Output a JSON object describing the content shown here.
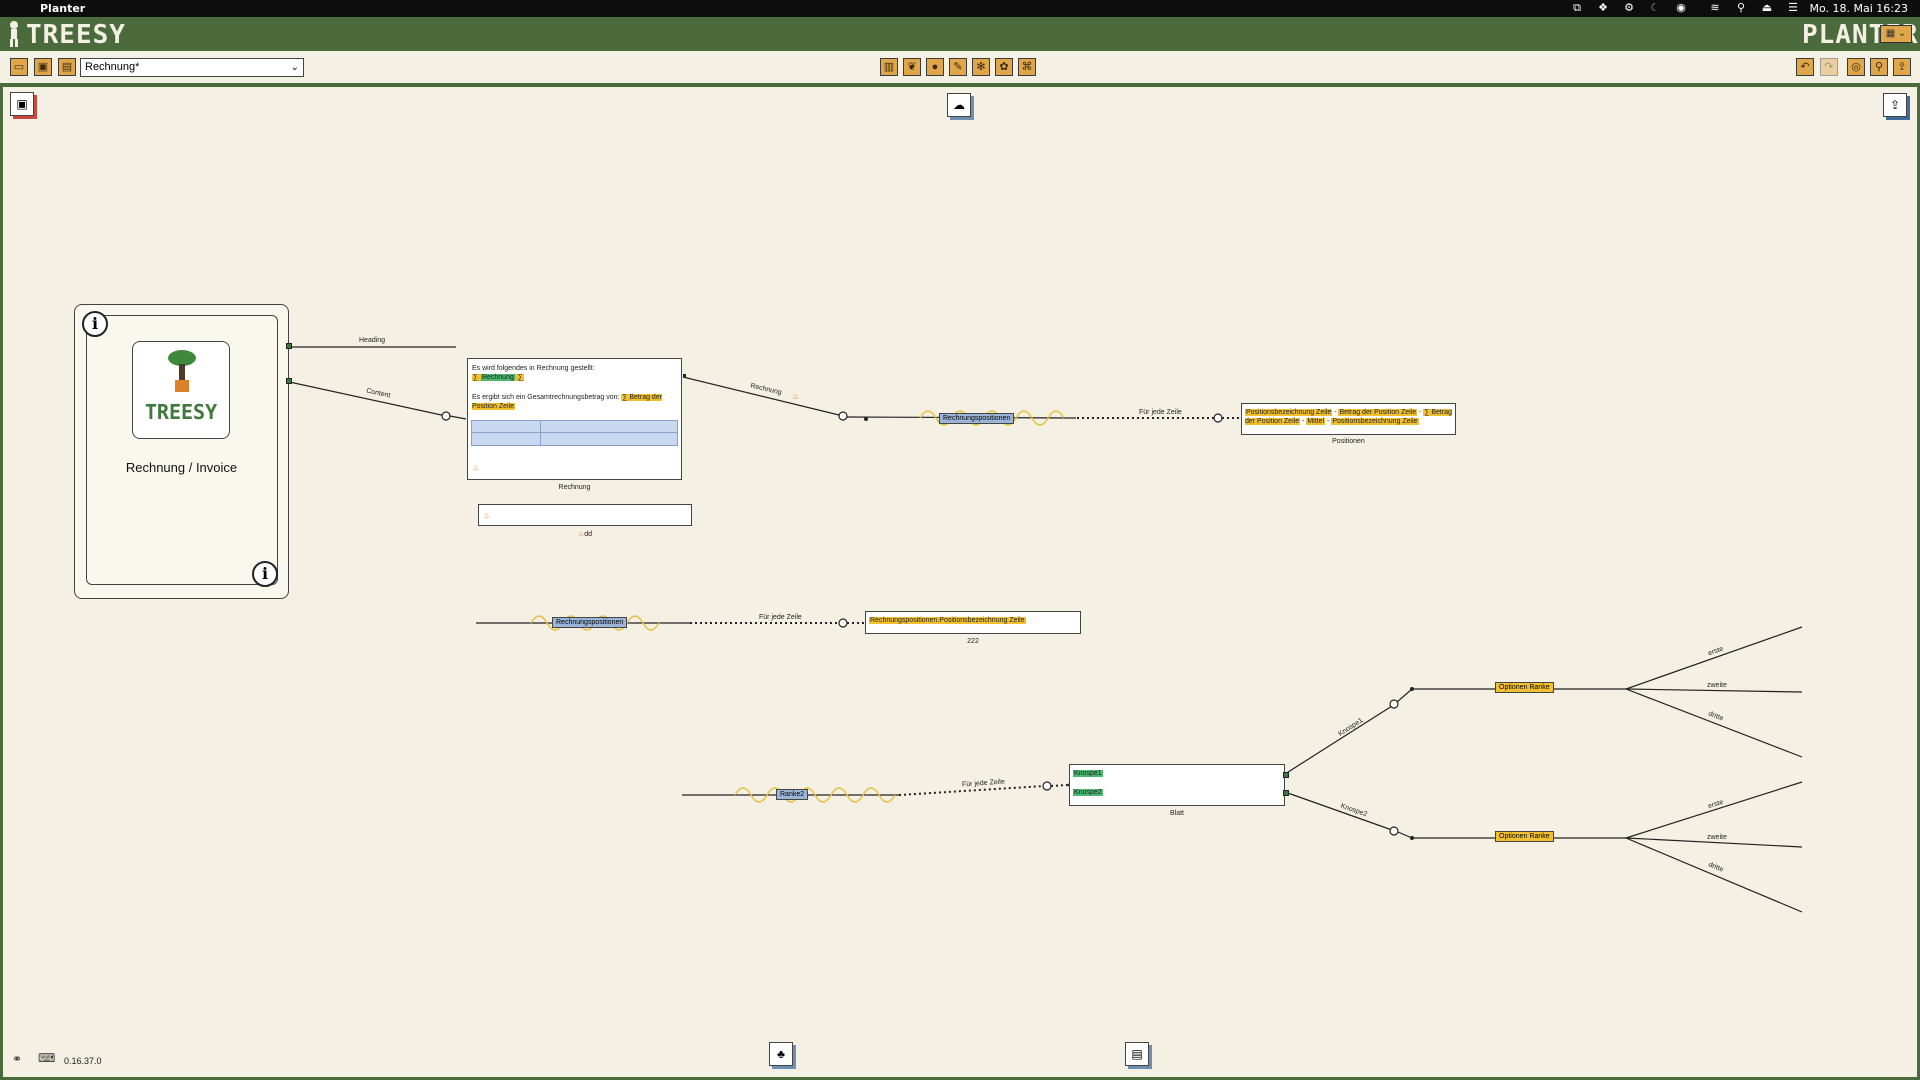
{
  "menubar": {
    "app_name": "Planter",
    "clock": "Mo. 18. Mai 16:23"
  },
  "header": {
    "left_logo": "TREESY",
    "right_logo": "PLANTER"
  },
  "toolbar": {
    "document_select": "Rechnung*"
  },
  "canvas": {
    "info_card": {
      "logo_text": "TREESY",
      "title": "Rechnung / Invoice"
    },
    "edges": {
      "heading": "Heading",
      "content": "Content",
      "rechnung": "Rechnung",
      "fur_jede_zeile": "Für jede Zeile",
      "knospe1": "Knospe1",
      "knospe2": "Knospe2",
      "erste": "erste",
      "zweite": "zweite",
      "dritte": "dritte"
    },
    "node_rechnung": {
      "line1": "Es wird folgendes in Rechnung gestellt:",
      "tag_rechnung": "Rechnung",
      "line2_prefix": "Es ergibt sich ein Gesamtrechnungsbetrag von:",
      "tag_betrag": "∑ Betrag der Position Zeile",
      "caption": "Rechnung"
    },
    "node_dd": {
      "caption": "dd"
    },
    "tag_rechnungspositionen": "Rechnungspositionen",
    "node_positionen": {
      "t1": "Positionsbezeichnung Zeile",
      "t2": "Betrag der Position Zeile",
      "t3": "∑ Betrag der Position Zeile",
      "t4": "Mittel",
      "t5": "Positionsbezeichnung Zeile",
      "sep": "-",
      "caption": "Positionen"
    },
    "node_222": {
      "text": "Rechnungspositionen.Positionsbezeichnung Zeile",
      "caption": "222"
    },
    "tag_ranke2": "Ranke2",
    "node_blatt": {
      "knospe1": "Knospe1",
      "knospe2": "Knospe2",
      "caption": "Blatt"
    },
    "tag_optionen": "Optionen Ranke",
    "version": "0.16.37.0"
  },
  "colors": {
    "header_green": "#4c6b3d",
    "canvas": "#f4f0e4",
    "button_orange": "#e0a64a",
    "highlight_yellow": "#f0c030",
    "highlight_green": "#4cb870",
    "tag_blue": "#9ab5d8"
  }
}
